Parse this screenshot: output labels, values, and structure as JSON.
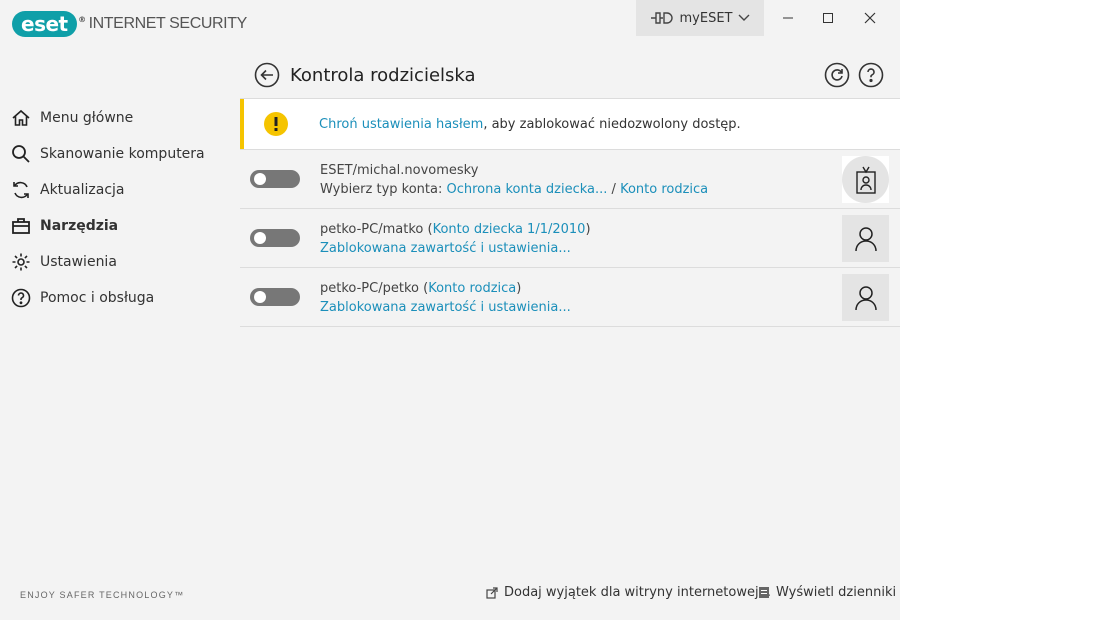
{
  "header": {
    "logo_text": "eset",
    "logo_reg": "®",
    "product_name": "INTERNET SECURITY",
    "myeset_label": "myESET",
    "brand_color": "#0f9fa8"
  },
  "sidebar": {
    "items": [
      {
        "label": "Menu główne",
        "icon": "home-icon"
      },
      {
        "label": "Skanowanie komputera",
        "icon": "search-icon"
      },
      {
        "label": "Aktualizacja",
        "icon": "refresh-icon"
      },
      {
        "label": "Narzędzia",
        "icon": "toolbox-icon",
        "active": true
      },
      {
        "label": "Ustawienia",
        "icon": "gear-icon"
      },
      {
        "label": "Pomoc i obsługa",
        "icon": "help-icon"
      }
    ],
    "tagline": "ENJOY SAFER TECHNOLOGY™"
  },
  "page": {
    "title": "Kontrola rodzicielska"
  },
  "notice": {
    "link_text": "Chroń ustawienia hasłem",
    "rest_text": ", aby zablokować niedozwolony dostęp.",
    "accent_color": "#f5c400"
  },
  "users": [
    {
      "name": "ESET/michal.novomesky",
      "line2_prefix": "Wybierz typ konta: ",
      "link_a": "Ochrona konta dziecka...",
      "separator": " / ",
      "link_b": "Konto rodzica",
      "enabled": false
    },
    {
      "name": "petko-PC/matko",
      "paren_open": " (",
      "account_link": "Konto dziecka 1/1/2010",
      "paren_close": ")",
      "blocked_link": "Zablokowana zawartość i ustawienia...",
      "enabled": false
    },
    {
      "name": "petko-PC/petko",
      "paren_open": " (",
      "account_link": "Konto rodzica",
      "paren_close": ")",
      "blocked_link": "Zablokowana zawartość i ustawienia...",
      "enabled": false
    }
  ],
  "footer": {
    "add_exception": "Dodaj wyjątek dla witryny internetowej...",
    "show_logs": "Wyświetl dzienniki"
  },
  "link_color": "#1b8fba"
}
